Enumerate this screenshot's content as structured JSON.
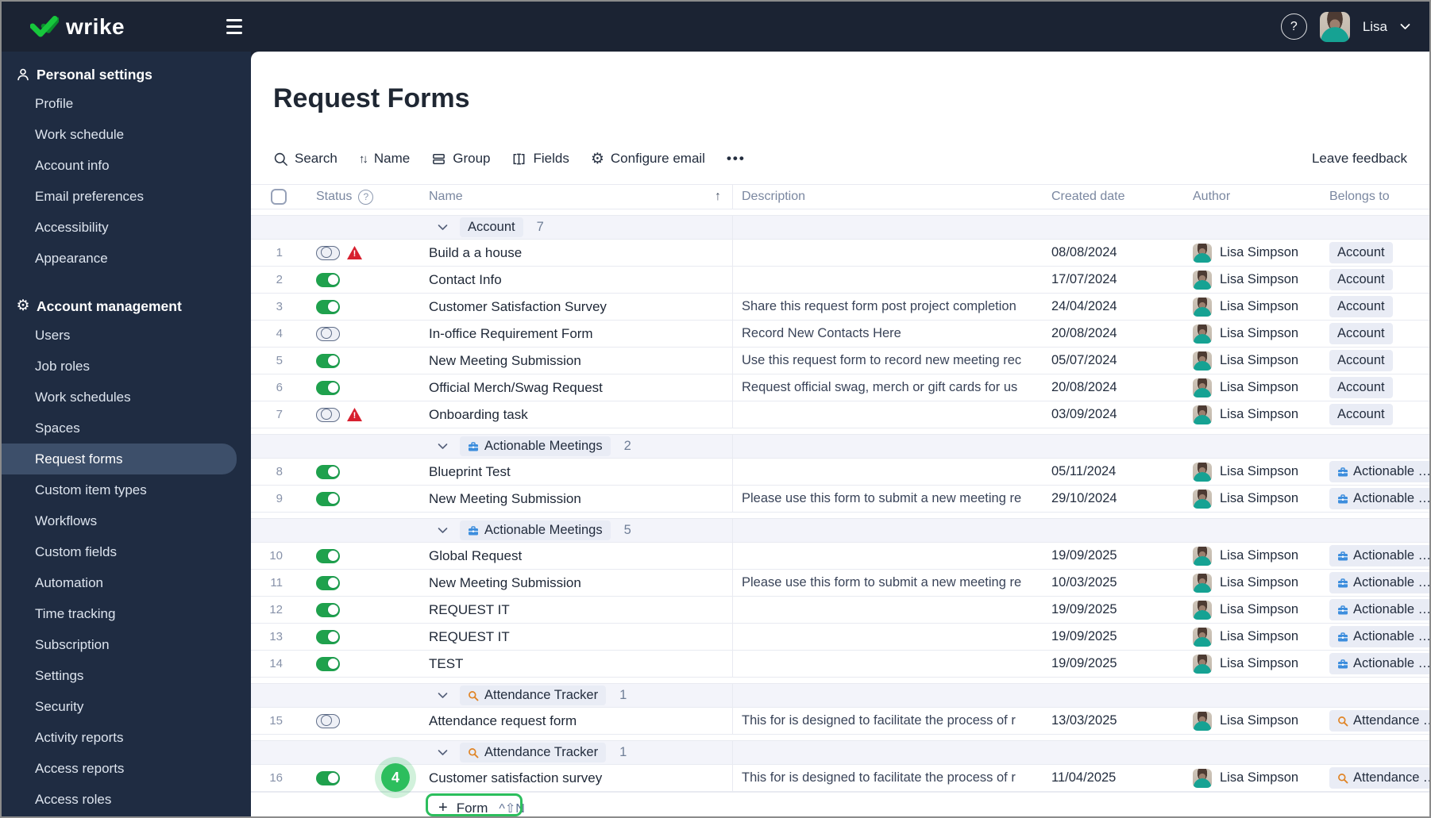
{
  "topbar": {
    "logo": "wrike",
    "user": "Lisa"
  },
  "sidebar": {
    "sections": [
      {
        "icon": "person-icon",
        "label": "Personal settings",
        "selected": null,
        "items": [
          "Profile",
          "Work schedule",
          "Account info",
          "Email preferences",
          "Accessibility",
          "Appearance"
        ]
      },
      {
        "icon": "gear-icon",
        "label": "Account management",
        "selected": "Request forms",
        "items": [
          "Users",
          "Job roles",
          "Work schedules",
          "Spaces",
          "Request forms",
          "Custom item types",
          "Workflows",
          "Custom fields",
          "Automation",
          "Time tracking",
          "Subscription",
          "Settings",
          "Security",
          "Activity reports",
          "Access reports",
          "Access roles"
        ]
      }
    ]
  },
  "page": {
    "title": "Request Forms",
    "leave_feedback": "Leave feedback"
  },
  "toolbar": {
    "search": "Search",
    "sort_by": "Name",
    "group": "Group",
    "fields": "Fields",
    "configure_email": "Configure email",
    "more": "•••"
  },
  "table": {
    "header": {
      "status": "Status",
      "name": "Name",
      "description": "Description",
      "created": "Created date",
      "author": "Author",
      "belongs": "Belongs to"
    },
    "groups": [
      {
        "icon": null,
        "label": "Account",
        "count": "7",
        "rows": [
          {
            "num": "1",
            "toggle": "off",
            "warning": true,
            "name": "Build a a house",
            "description": "",
            "created": "08/08/2024",
            "author": "Lisa Simpson",
            "belongs": "Account",
            "belongs_icon": null
          },
          {
            "num": "2",
            "toggle": "on",
            "warning": false,
            "name": "Contact Info",
            "description": "",
            "created": "17/07/2024",
            "author": "Lisa Simpson",
            "belongs": "Account",
            "belongs_icon": null
          },
          {
            "num": "3",
            "toggle": "on",
            "warning": false,
            "name": "Customer Satisfaction Survey",
            "description": "Share this request form post project completion",
            "created": "24/04/2024",
            "author": "Lisa Simpson",
            "belongs": "Account",
            "belongs_icon": null
          },
          {
            "num": "4",
            "toggle": "off",
            "warning": false,
            "name": "In-office Requirement Form",
            "description": "Record New Contacts Here",
            "created": "20/08/2024",
            "author": "Lisa Simpson",
            "belongs": "Account",
            "belongs_icon": null
          },
          {
            "num": "5",
            "toggle": "on",
            "warning": false,
            "name": "New Meeting Submission",
            "description": "Use this request form to record new meeting rec",
            "created": "05/07/2024",
            "author": "Lisa Simpson",
            "belongs": "Account",
            "belongs_icon": null
          },
          {
            "num": "6",
            "toggle": "on",
            "warning": false,
            "name": "Official Merch/Swag Request",
            "description": "Request official swag, merch or gift cards for us",
            "created": "20/08/2024",
            "author": "Lisa Simpson",
            "belongs": "Account",
            "belongs_icon": null
          },
          {
            "num": "7",
            "toggle": "off",
            "warning": true,
            "name": "Onboarding task",
            "description": "",
            "created": "03/09/2024",
            "author": "Lisa Simpson",
            "belongs": "Account",
            "belongs_icon": null
          }
        ]
      },
      {
        "icon": "briefcase-icon",
        "label": "Actionable Meetings",
        "count": "2",
        "rows": [
          {
            "num": "8",
            "toggle": "on",
            "warning": false,
            "name": "Blueprint Test",
            "description": "",
            "created": "05/11/2024",
            "author": "Lisa Simpson",
            "belongs": "Actionable Meetings",
            "belongs_icon": "briefcase-icon"
          },
          {
            "num": "9",
            "toggle": "on",
            "warning": false,
            "name": "New Meeting Submission",
            "description": "Please use this form to submit a new meeting re",
            "created": "29/10/2024",
            "author": "Lisa Simpson",
            "belongs": "Actionable Meetings",
            "belongs_icon": "briefcase-icon"
          }
        ]
      },
      {
        "icon": "briefcase-icon",
        "label": "Actionable Meetings",
        "count": "5",
        "rows": [
          {
            "num": "10",
            "toggle": "on",
            "warning": false,
            "name": "Global Request",
            "description": "",
            "created": "19/09/2025",
            "author": "Lisa Simpson",
            "belongs": "Actionable Meetings",
            "belongs_icon": "briefcase-icon"
          },
          {
            "num": "11",
            "toggle": "on",
            "warning": false,
            "name": "New Meeting Submission",
            "description": "Please use this form to submit a new meeting re",
            "created": "10/03/2025",
            "author": "Lisa Simpson",
            "belongs": "Actionable Meetings",
            "belongs_icon": "briefcase-icon"
          },
          {
            "num": "12",
            "toggle": "on",
            "warning": false,
            "name": "REQUEST IT",
            "description": "",
            "created": "19/09/2025",
            "author": "Lisa Simpson",
            "belongs": "Actionable Meetings",
            "belongs_icon": "briefcase-icon"
          },
          {
            "num": "13",
            "toggle": "on",
            "warning": false,
            "name": "REQUEST IT",
            "description": "",
            "created": "19/09/2025",
            "author": "Lisa Simpson",
            "belongs": "Actionable Meetings",
            "belongs_icon": "briefcase-icon"
          },
          {
            "num": "14",
            "toggle": "on",
            "warning": false,
            "name": "TEST",
            "description": "",
            "created": "19/09/2025",
            "author": "Lisa Simpson",
            "belongs": "Actionable Meetings",
            "belongs_icon": "briefcase-icon"
          }
        ]
      },
      {
        "icon": "search-icon",
        "label": "Attendance Tracker",
        "count": "1",
        "rows": [
          {
            "num": "15",
            "toggle": "off",
            "warning": false,
            "name": "Attendance request form",
            "description": "This for is designed to facilitate the process of r",
            "created": "13/03/2025",
            "author": "Lisa Simpson",
            "belongs": "Attendance Tracker",
            "belongs_icon": "search-icon"
          }
        ]
      },
      {
        "icon": "search-icon",
        "label": "Attendance Tracker",
        "count": "1",
        "rows": [
          {
            "num": "16",
            "toggle": "on",
            "warning": false,
            "name": "Customer satisfaction survey",
            "description": "This for is designed to facilitate the process of r",
            "created": "11/04/2025",
            "author": "Lisa Simpson",
            "belongs": "Attendance Tracker",
            "belongs_icon": "search-icon"
          }
        ]
      }
    ]
  },
  "add_form": {
    "plus": "+",
    "label": "Form",
    "shortcut": "^⇧N",
    "badge": "4"
  }
}
